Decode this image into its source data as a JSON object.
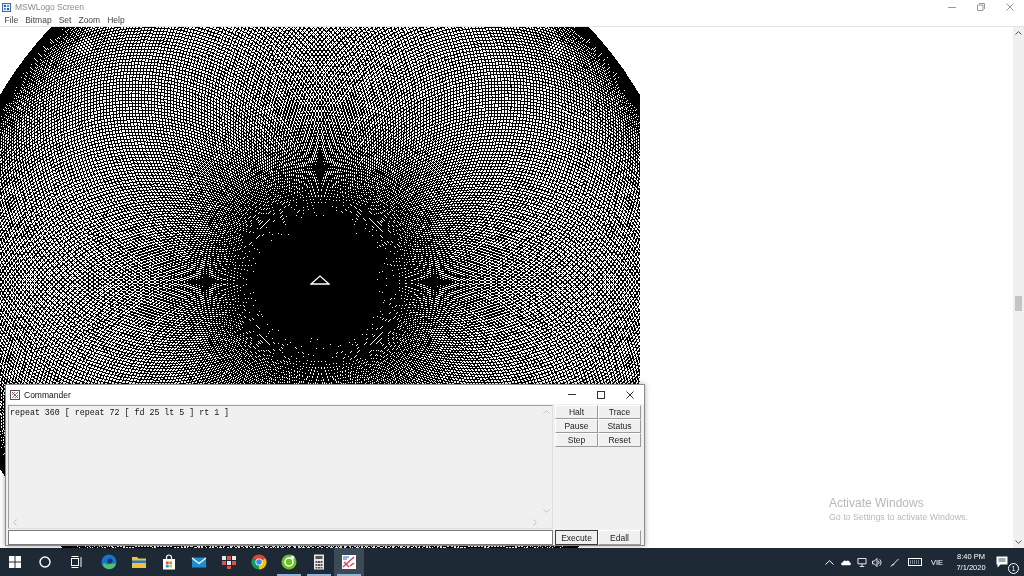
{
  "window": {
    "title": "MSWLogo Screen"
  },
  "menu": [
    "File",
    "Bitmap",
    "Set",
    "Zoom",
    "Help"
  ],
  "commander": {
    "title": "Commander",
    "history": [
      "repeat 360 [ repeat 72 [ fd 25 lt 5 ] rt 1 ]"
    ],
    "control_buttons": [
      "Halt",
      "Trace",
      "Pause",
      "Status",
      "Step",
      "Reset"
    ],
    "action_buttons": [
      {
        "label": "Execute",
        "default": true
      },
      {
        "label": "Edall",
        "default": false
      }
    ]
  },
  "activation_notice": {
    "title": "Activate Windows",
    "text": "Go to Settings to activate Windows."
  },
  "taskbar": {
    "apps": [
      {
        "kind": "swirl",
        "running": false,
        "selected": false
      },
      {
        "kind": "folder",
        "running": false,
        "selected": false
      },
      {
        "kind": "bag",
        "running": false,
        "selected": false
      },
      {
        "kind": "envelope",
        "running": false,
        "selected": false
      },
      {
        "kind": "tiles",
        "running": false,
        "selected": false
      },
      {
        "kind": "ring",
        "running": false,
        "selected": false
      },
      {
        "kind": "disc",
        "running": true,
        "selected": false
      },
      {
        "kind": "calculator",
        "running": true,
        "selected": false
      },
      {
        "kind": "picture",
        "running": true,
        "selected": true
      }
    ],
    "tray": {
      "language": "VIE",
      "time": "8:40 PM",
      "date": "7/1/2020",
      "notification_count": "1"
    }
  }
}
